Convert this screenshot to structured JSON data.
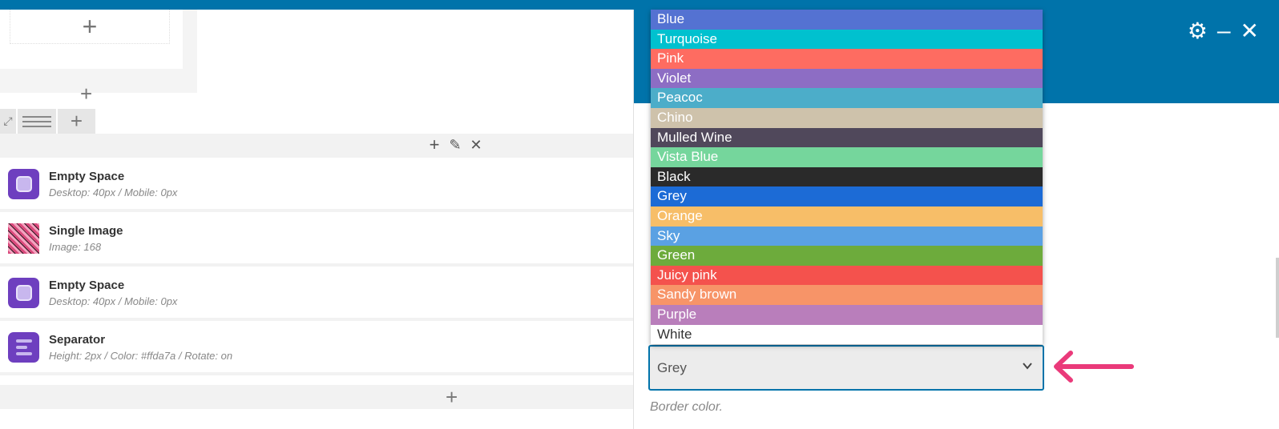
{
  "left": {
    "row_actions": {
      "add": "+",
      "edit": "✎",
      "delete": "✕"
    },
    "elements": [
      {
        "name": "Empty Space",
        "details": "Desktop: 40px /  Mobile: 0px",
        "icon": "empty-space-icon"
      },
      {
        "name": "Single Image",
        "details": "Image: 168",
        "icon": "image-thumbnail"
      },
      {
        "name": "Empty Space",
        "details": "Desktop: 40px /  Mobile: 0px",
        "icon": "empty-space-icon"
      },
      {
        "name": "Separator",
        "details": "Height: 2px /  Color: #ffda7a /  Rotate: on",
        "icon": "separator-icon"
      }
    ]
  },
  "panel": {
    "header_color": "#0073aa",
    "icons": [
      "gear-icon",
      "minimize-icon",
      "close-icon"
    ]
  },
  "dropdown": {
    "options": [
      {
        "label": "Blue",
        "color": "#5472d2"
      },
      {
        "label": "Turquoise",
        "color": "#00c1cf"
      },
      {
        "label": "Pink",
        "color": "#fe6c61"
      },
      {
        "label": "Violet",
        "color": "#8d6dc4"
      },
      {
        "label": "Peacoc",
        "color": "#4cadc9"
      },
      {
        "label": "Chino",
        "color": "#cec2ab"
      },
      {
        "label": "Mulled Wine",
        "color": "#50485b"
      },
      {
        "label": "Vista Blue",
        "color": "#75d69c"
      },
      {
        "label": "Black",
        "color": "#2a2a2a"
      },
      {
        "label": "Grey",
        "color": "#1c6bd6"
      },
      {
        "label": "Orange",
        "color": "#f7be68"
      },
      {
        "label": "Sky",
        "color": "#5aa1e3"
      },
      {
        "label": "Green",
        "color": "#6dab3c"
      },
      {
        "label": "Juicy pink",
        "color": "#f4524d"
      },
      {
        "label": "Sandy brown",
        "color": "#f79468"
      },
      {
        "label": "Purple",
        "color": "#b97ebb"
      },
      {
        "label": "White",
        "color": "#ffffff"
      }
    ]
  },
  "select": {
    "value": "Grey"
  },
  "hint": "Border color.",
  "accent_arrow_color": "#ea3a7a"
}
